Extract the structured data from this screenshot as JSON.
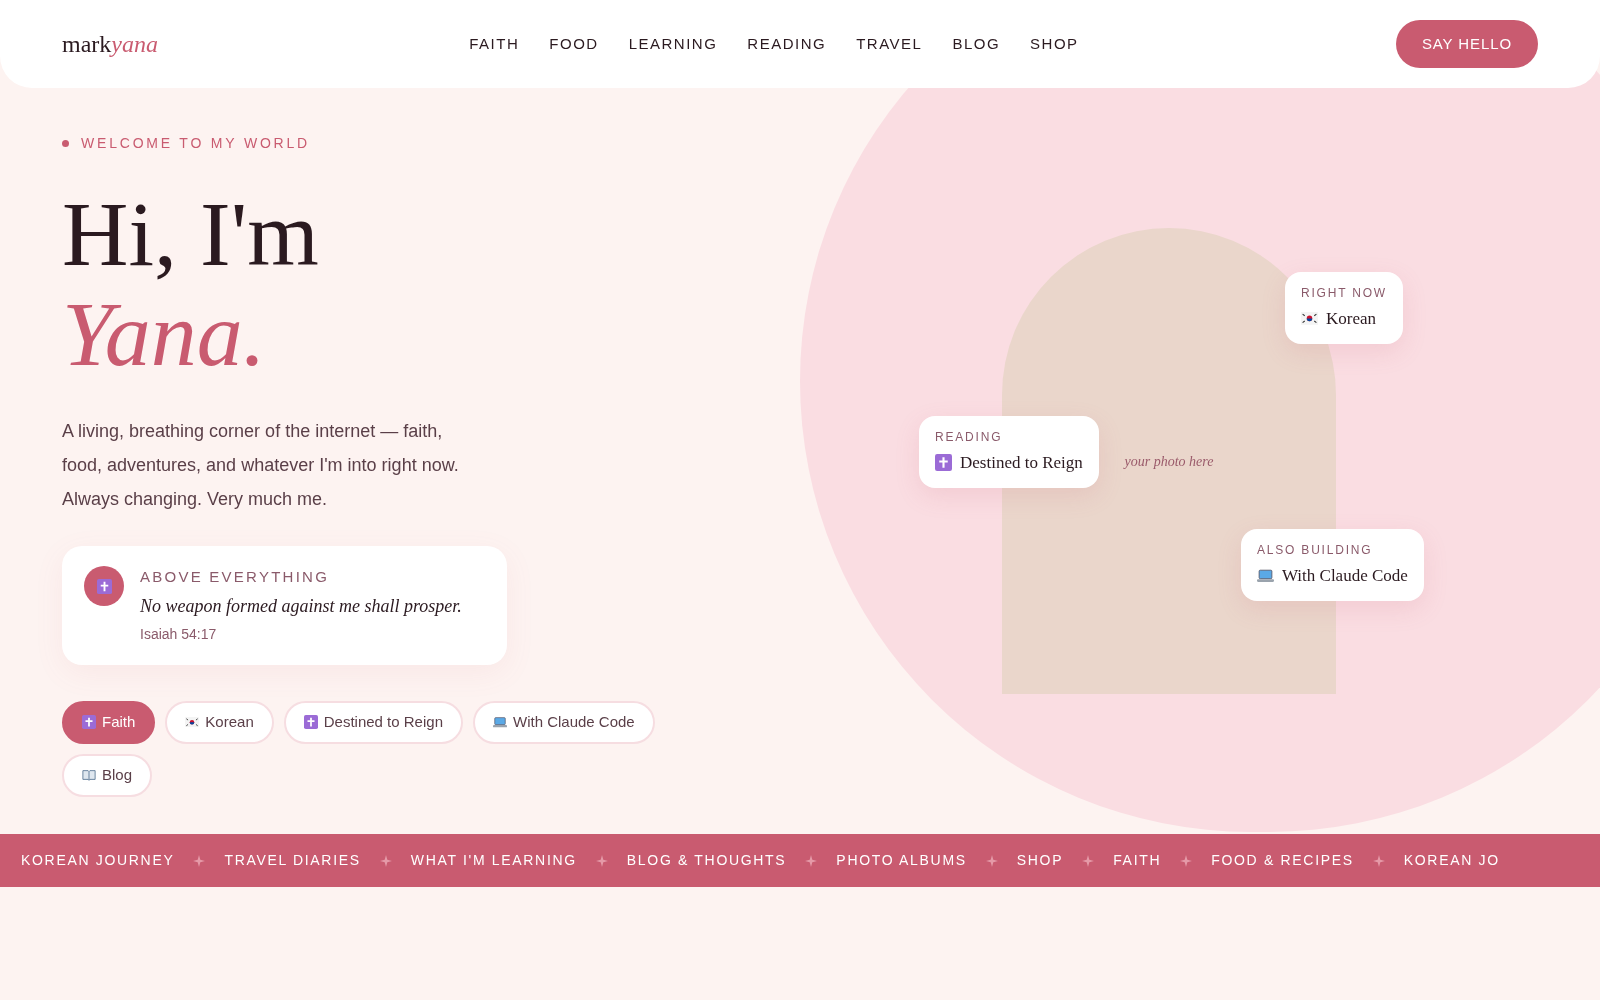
{
  "header": {
    "logo": {
      "main": "mark",
      "accent": "yana"
    },
    "nav": [
      {
        "label": "FAITH"
      },
      {
        "label": "FOOD"
      },
      {
        "label": "LEARNING"
      },
      {
        "label": "READING"
      },
      {
        "label": "TRAVEL"
      },
      {
        "label": "BLOG"
      },
      {
        "label": "SHOP"
      }
    ],
    "cta": "SAY HELLO"
  },
  "hero": {
    "eyebrow": "WELCOME TO MY WORLD",
    "title_line1": "Hi, I'm",
    "title_line2": "Yana.",
    "intro": "A living, breathing corner of the internet — faith, food, adventures, and whatever I'm into right now. Always changing. Very much me.",
    "verse": {
      "label": "ABOVE EVERYTHING",
      "quote": "No weapon formed against me shall prosper.",
      "reference": "Isaiah 54:17"
    },
    "chips": [
      {
        "kind": "cross",
        "label": "Faith",
        "selected": true
      },
      {
        "kind": "flag",
        "label": "Korean",
        "selected": false
      },
      {
        "kind": "cross",
        "label": "Destined to Reign",
        "selected": false
      },
      {
        "kind": "laptop",
        "label": "With Claude Code",
        "selected": false
      },
      {
        "kind": "book",
        "label": "Blog",
        "selected": false
      }
    ]
  },
  "photo": {
    "placeholder_text": "your photo here",
    "cards": [
      {
        "kind": "flag",
        "label": "RIGHT NOW",
        "value": "Korean"
      },
      {
        "kind": "cross",
        "label": "READING",
        "value": "Destined to Reign"
      },
      {
        "kind": "laptop",
        "label": "ALSO BUILDING",
        "value": "With Claude Code"
      }
    ]
  },
  "ticker": [
    "KOREAN JOURNEY",
    "TRAVEL DIARIES",
    "WHAT I'M LEARNING",
    "BLOG & THOUGHTS",
    "PHOTO ALBUMS",
    "SHOP",
    "FAITH",
    "FOOD & RECIPES",
    "KOREAN JO"
  ]
}
